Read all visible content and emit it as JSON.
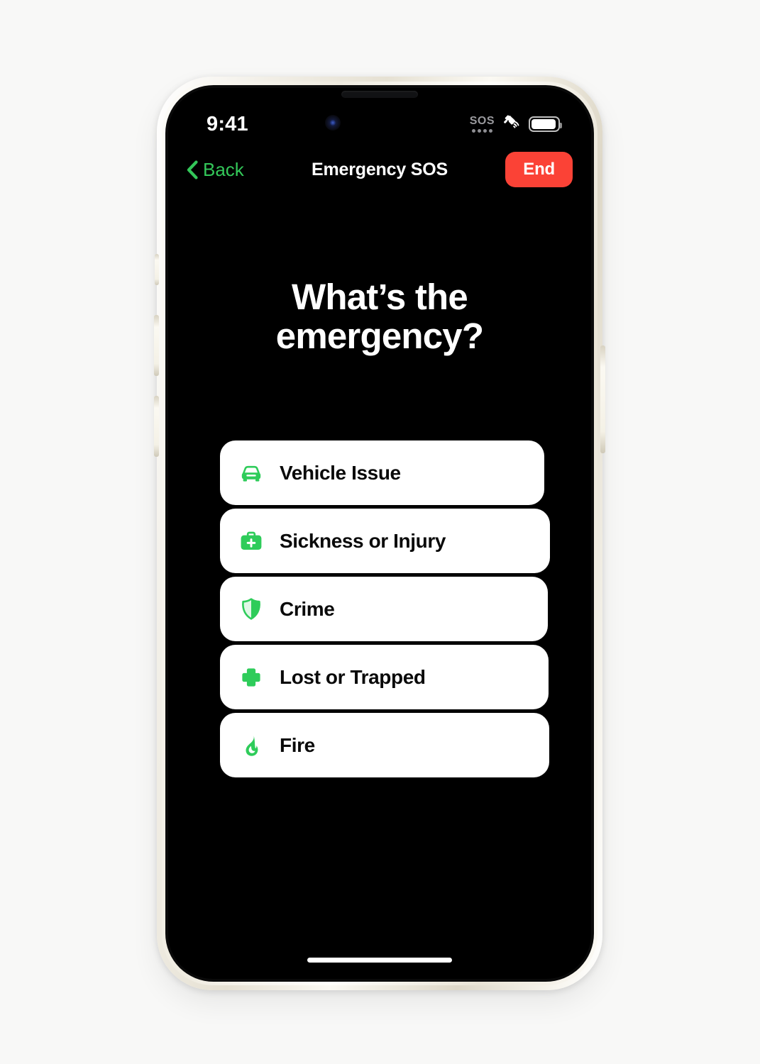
{
  "device": {
    "frame_color": "#efeade",
    "screen_background": "#000000",
    "page_background": "#f8f8f7"
  },
  "status_bar": {
    "time": "9:41",
    "sos_label": "SOS",
    "sos_dot_count": 4,
    "satellite_icon": "satellite-icon",
    "battery_icon": "battery-icon",
    "battery_level_percent": 90
  },
  "nav_bar": {
    "back_label": "Back",
    "back_icon": "chevron-left-icon",
    "title": "Emergency SOS",
    "end_label": "End",
    "back_color": "#33c759",
    "end_color": "#fb4236"
  },
  "main": {
    "heading_line1": "What’s the",
    "heading_line2": "emergency?",
    "accent_color": "#2ecc5a",
    "options": [
      {
        "label": "Vehicle Issue",
        "icon": "car-icon"
      },
      {
        "label": "Sickness or Injury",
        "icon": "medical-kit-icon"
      },
      {
        "label": "Crime",
        "icon": "shield-icon"
      },
      {
        "label": "Lost or Trapped",
        "icon": "plus-cross-icon"
      },
      {
        "label": "Fire",
        "icon": "flame-icon"
      }
    ]
  },
  "home_indicator": {
    "label": "home-indicator"
  }
}
